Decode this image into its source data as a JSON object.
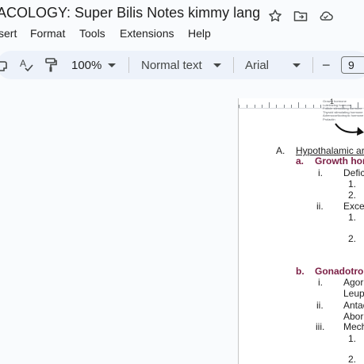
{
  "doc_title": "ACOLOGY: Super Bilis Notes kimmy lang",
  "menu": [
    "sert",
    "Format",
    "Tools",
    "Extensions",
    "Help"
  ],
  "toolbar": {
    "zoom": "100%",
    "style": "Normal text",
    "font": "Arial",
    "minus": "−",
    "font_size": "9"
  },
  "ruler": {
    "marker": "1"
  },
  "image_text": [
    "Growth hormone",
    "Luteinizing hormone",
    "Follicle stimulating hormone",
    "Thyroid stimulating hormone",
    "Adrenocorticotropic hormone",
    "Prolactin"
  ],
  "outline": [
    {
      "marker": "A.",
      "text": "Hypothalamic ar",
      "style": "underline"
    },
    {
      "marker": "a.",
      "text": "Growth hor",
      "style": "maroon"
    },
    {
      "marker": "i.",
      "text": "Defic",
      "style": "plain"
    },
    {
      "marker": "1.",
      "text": "",
      "style": "plain"
    },
    {
      "marker": "2.",
      "text": "",
      "style": "plain"
    },
    {
      "marker": "ii.",
      "text": "Exce",
      "style": "plain"
    },
    {
      "marker": "1.",
      "text": "",
      "style": "plain"
    },
    {
      "marker": "2.",
      "text": "",
      "style": "plain"
    },
    {
      "marker": "b.",
      "text": "Gonadotro",
      "style": "maroon"
    },
    {
      "marker": "i.",
      "text": "Agor",
      "style": "plain"
    },
    {
      "marker": "",
      "text": "Leup",
      "style": "plain"
    },
    {
      "marker": "ii.",
      "text": "Antac",
      "style": "plain"
    },
    {
      "marker": "",
      "text": "Abor",
      "style": "plain"
    },
    {
      "marker": "iii.",
      "text": "Mech",
      "style": "plain"
    },
    {
      "marker": "1.",
      "text": "",
      "style": "plain"
    },
    {
      "marker": "2.",
      "text": "",
      "style": "plain"
    }
  ]
}
